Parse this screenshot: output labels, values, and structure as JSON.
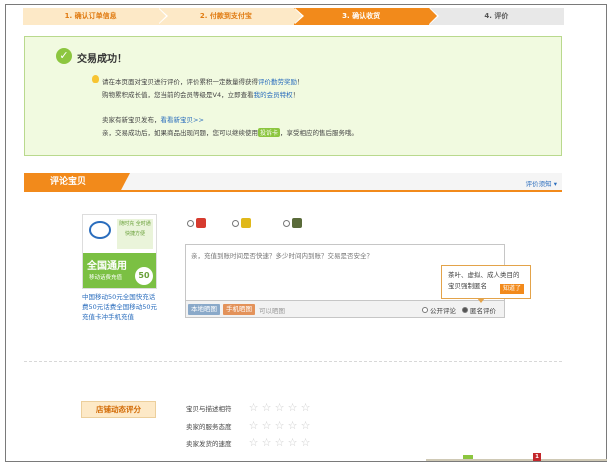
{
  "steps": [
    {
      "label": "1. 确认订单信息"
    },
    {
      "label": "2. 付款到支付宝"
    },
    {
      "label": "3. 确认收货"
    },
    {
      "label": "4. 评价"
    }
  ],
  "success": {
    "title": "交易成功！",
    "line1_a": "请在本页面对宝贝进行评价，评价累积一定数量得获得",
    "line1_link": "评价勤劳奖励",
    "line1_b": "！",
    "line2_a": "购物累积成长值，您当前的会员等级是V4，立即查看",
    "line2_link": "我的会员特权",
    "line2_b": "！",
    "line3_a": "卖家有新宝贝发布，",
    "line3_link": "看看新宝贝>>",
    "line4_a": "亲，交易成功后，如果商品出现问题，您可以继续使用",
    "line4_badge": "投诉卡",
    "line4_b": "，享受相应的售后服务哦。"
  },
  "review": {
    "tab_label": "评论宝贝",
    "help_label": "评价须知 ▾"
  },
  "product": {
    "big_text": "全国通用",
    "small_text": "移动话费充值",
    "num": "50",
    "ph_text": "随时充\n全时通\n快捷方便",
    "name": "中国移动50元全国快充话费50元话费全国移动50元充值卡冲手机充值"
  },
  "comment": {
    "placeholder": "亲，充值到账时间是否快速？多少时间内到账？交易是否安全？",
    "btn_local": "本地晒图",
    "btn_phone": "手机晒图",
    "hint": "可以晒图",
    "opt_public": "公开评论",
    "opt_anon": "匿名评价"
  },
  "tooltip": {
    "text": "茶叶、虚拟、成人类目的宝贝强制匿名",
    "know": "知道了"
  },
  "shop": {
    "label": "店铺动态评分",
    "rows": [
      {
        "label": "宝贝与描述相符"
      },
      {
        "label": "卖家的服务态度"
      },
      {
        "label": "卖家发货的速度"
      }
    ]
  },
  "bottom": {
    "badge": "1"
  },
  "colors": {
    "accent": "#f28a1b",
    "success_bg": "#f1fae0",
    "link": "#2a6dbd",
    "green": "#8cc63f"
  }
}
